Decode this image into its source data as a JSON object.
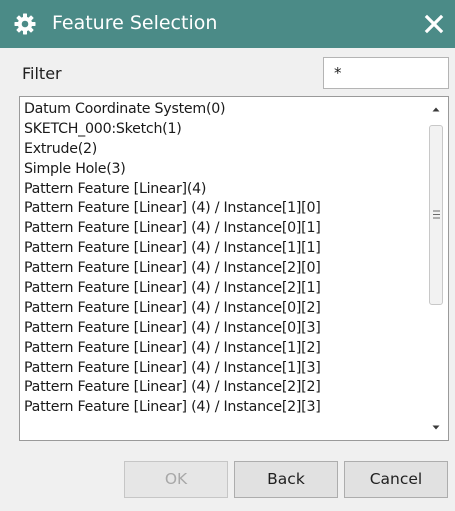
{
  "dialog": {
    "title": "Feature Selection",
    "icons": {
      "title": "gear-icon",
      "close": "close-icon"
    },
    "colors": {
      "titlebar": "#4b8b87",
      "background": "#f0f0f0"
    }
  },
  "filter": {
    "label": "Filter",
    "value": "*"
  },
  "features": [
    "Datum Coordinate System(0)",
    "SKETCH_000:Sketch(1)",
    "Extrude(2)",
    "Simple Hole(3)",
    "Pattern Feature [Linear](4)",
    "Pattern Feature [Linear] (4) / Instance[1][0]",
    "Pattern Feature [Linear] (4) / Instance[0][1]",
    "Pattern Feature [Linear] (4) / Instance[1][1]",
    "Pattern Feature [Linear] (4) / Instance[2][0]",
    "Pattern Feature [Linear] (4) / Instance[2][1]",
    "Pattern Feature [Linear] (4) / Instance[0][2]",
    "Pattern Feature [Linear] (4) / Instance[0][3]",
    "Pattern Feature [Linear] (4) / Instance[1][2]",
    "Pattern Feature [Linear] (4) / Instance[1][3]",
    "Pattern Feature [Linear] (4) / Instance[2][2]",
    "Pattern Feature [Linear] (4) / Instance[2][3]"
  ],
  "buttons": {
    "ok": "OK",
    "back": "Back",
    "cancel": "Cancel"
  }
}
